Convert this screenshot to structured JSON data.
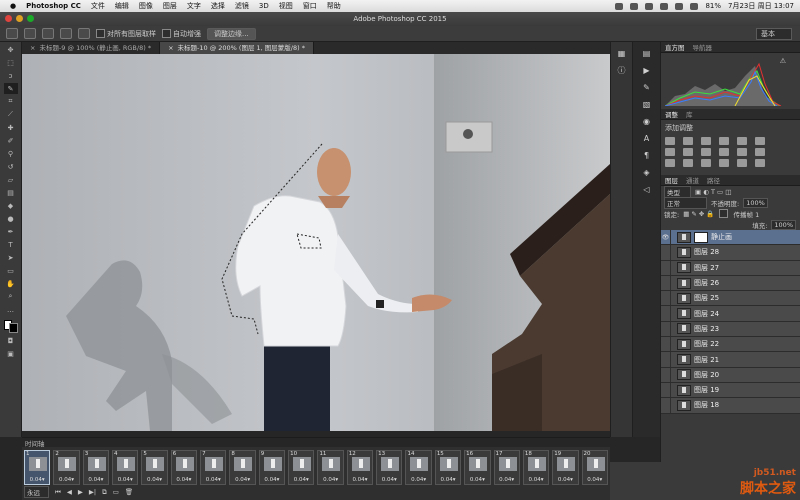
{
  "menubar": {
    "app": "Photoshop CC",
    "items": [
      "文件",
      "编辑",
      "图像",
      "图层",
      "文字",
      "选择",
      "滤镜",
      "3D",
      "视图",
      "窗口",
      "帮助"
    ],
    "battery": "81%",
    "datetime": "7月23日 周日 13:07"
  },
  "window": {
    "title": "Adobe Photoshop CC 2015"
  },
  "options": {
    "sample_all_layers": "对所有图层取样",
    "auto_enhance": "自动增强",
    "refine_edge": "调整边缘...",
    "workspace": "基本"
  },
  "tabs": [
    {
      "label": "未标题-9 @ 100% (静止画, RGB/8) *",
      "active": false
    },
    {
      "label": "未标题-10 @ 200% (图层 1, 图层蒙版/8) *",
      "active": true
    }
  ],
  "panels": {
    "histogram_tabs": [
      "直方图",
      "导航器"
    ],
    "adjust_tabs": [
      "调整",
      "库"
    ],
    "adjust_title": "添加调整",
    "layer_tabs": [
      "图层",
      "通道",
      "路径"
    ],
    "kind": "类型",
    "blend": "正常",
    "opacity_label": "不透明度:",
    "opacity": "100%",
    "lock_label": "锁定:",
    "propagate": "传播帧 1",
    "fill_label": "填充:",
    "fill": "100%",
    "layers": [
      {
        "name": "静止画",
        "selected": true,
        "mask": true
      },
      {
        "name": "图层 28"
      },
      {
        "name": "图层 27"
      },
      {
        "name": "图层 26"
      },
      {
        "name": "图层 25"
      },
      {
        "name": "图层 24"
      },
      {
        "name": "图层 23"
      },
      {
        "name": "图层 22"
      },
      {
        "name": "图层 21"
      },
      {
        "name": "图层 20"
      },
      {
        "name": "图层 19"
      },
      {
        "name": "图层 18"
      }
    ]
  },
  "timeline": {
    "title": "时间轴",
    "loop": "永远",
    "frames": [
      {
        "num": "1",
        "delay": "0.04"
      },
      {
        "num": "2",
        "delay": "0.04"
      },
      {
        "num": "3",
        "delay": "0.04"
      },
      {
        "num": "4",
        "delay": "0.04"
      },
      {
        "num": "5",
        "delay": "0.04"
      },
      {
        "num": "6",
        "delay": "0.04"
      },
      {
        "num": "7",
        "delay": "0.04"
      },
      {
        "num": "8",
        "delay": "0.04"
      },
      {
        "num": "9",
        "delay": "0.04"
      },
      {
        "num": "10",
        "delay": "0.04"
      },
      {
        "num": "11",
        "delay": "0.04"
      },
      {
        "num": "12",
        "delay": "0.04"
      },
      {
        "num": "13",
        "delay": "0.04"
      },
      {
        "num": "14",
        "delay": "0.04"
      },
      {
        "num": "15",
        "delay": "0.04"
      },
      {
        "num": "16",
        "delay": "0.04"
      },
      {
        "num": "17",
        "delay": "0.04"
      },
      {
        "num": "18",
        "delay": "0.04"
      },
      {
        "num": "19",
        "delay": "0.04"
      },
      {
        "num": "20",
        "delay": "0.04"
      }
    ]
  },
  "watermark": {
    "site": "jb51.net",
    "name": "脚本之家"
  },
  "colors": {
    "selected_layer": "#5b6f8f",
    "watermark": "#e05a10"
  }
}
